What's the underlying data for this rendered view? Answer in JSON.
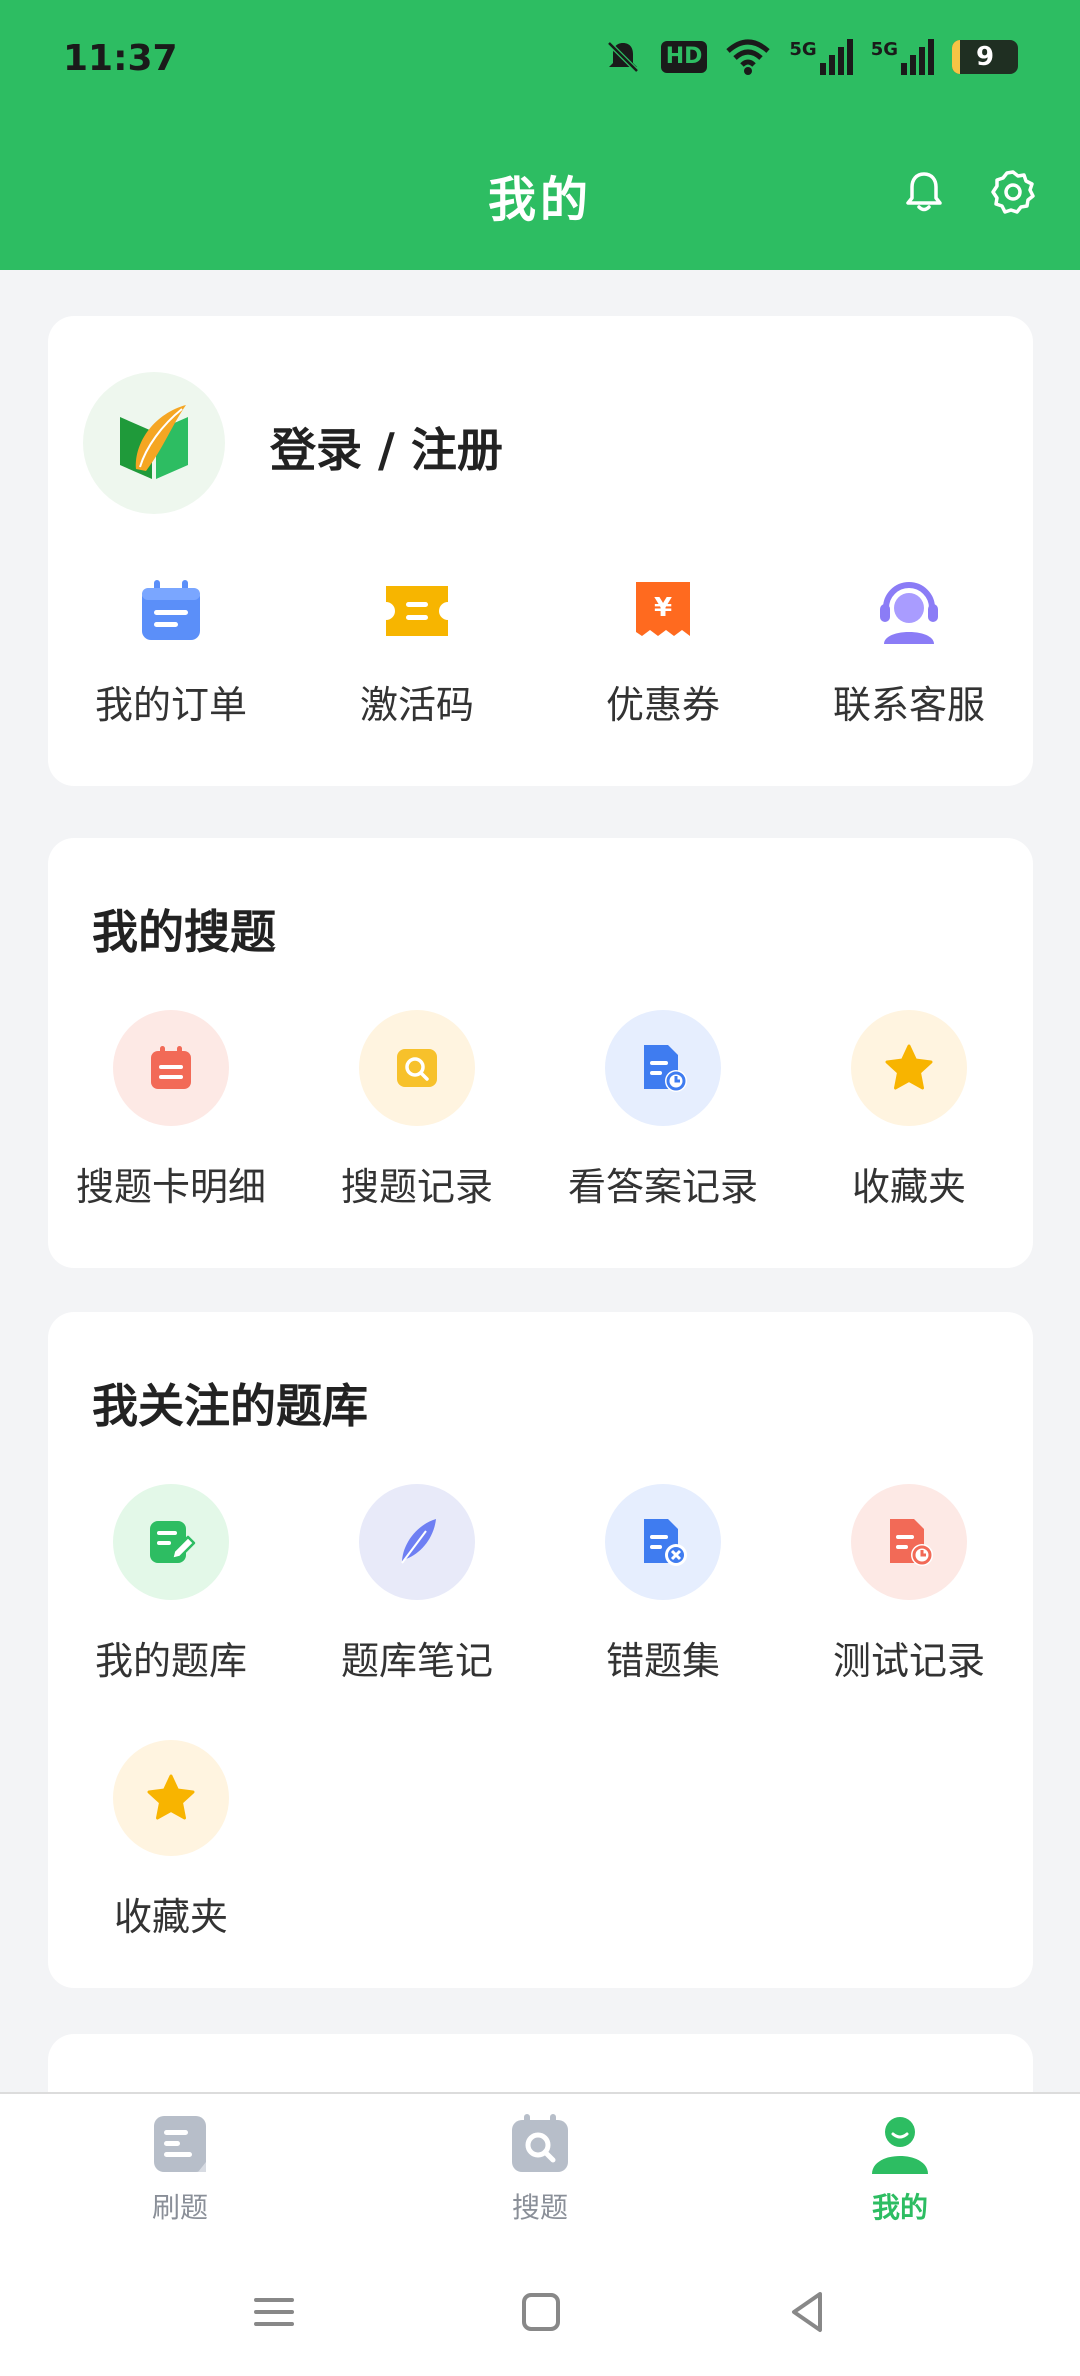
{
  "status_bar": {
    "time": "11:37",
    "hd_label": "HD",
    "signal_5g": "5G",
    "battery": "9"
  },
  "header": {
    "title": "我的"
  },
  "profile": {
    "login_label": "登录 / 注册"
  },
  "quick_actions": [
    {
      "label": "我的订单",
      "icon": "calendar-order-icon"
    },
    {
      "label": "激活码",
      "icon": "ticket-icon"
    },
    {
      "label": "优惠券",
      "icon": "coupon-icon"
    },
    {
      "label": "联系客服",
      "icon": "customer-service-icon"
    }
  ],
  "my_search": {
    "title": "我的搜题",
    "items": [
      {
        "label": "搜题卡明细",
        "icon": "card-detail-icon"
      },
      {
        "label": "搜题记录",
        "icon": "search-record-icon"
      },
      {
        "label": "看答案记录",
        "icon": "answer-record-icon"
      },
      {
        "label": "收藏夹",
        "icon": "star-icon"
      }
    ]
  },
  "followed_bank": {
    "title": "我关注的题库",
    "items": [
      {
        "label": "我的题库",
        "icon": "edit-doc-icon"
      },
      {
        "label": "题库笔记",
        "icon": "feather-icon"
      },
      {
        "label": "错题集",
        "icon": "wrong-doc-icon"
      },
      {
        "label": "测试记录",
        "icon": "test-record-icon"
      },
      {
        "label": "收藏夹",
        "icon": "star-icon"
      }
    ]
  },
  "tabbar": {
    "items": [
      {
        "label": "刷题",
        "active": false
      },
      {
        "label": "搜题",
        "active": false
      },
      {
        "label": "我的",
        "active": true
      }
    ]
  },
  "colors": {
    "brand": "#2dbd62",
    "background": "#f3f4f6"
  }
}
